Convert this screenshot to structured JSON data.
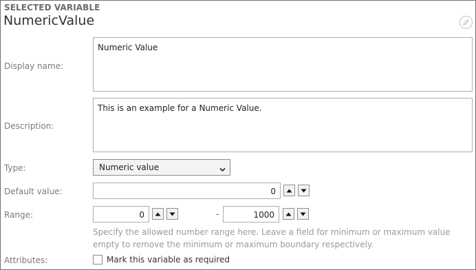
{
  "header": {
    "section_title": "SELECTED VARIABLE",
    "variable_name": "NumericValue",
    "edit_icon": "pencil-circle-icon"
  },
  "fields": {
    "display_name": {
      "label": "Display name:",
      "value": "Numeric Value"
    },
    "description": {
      "label": "Description:",
      "value": "This is an example for a Numeric Value."
    },
    "type": {
      "label": "Type:",
      "selected": "Numeric value"
    },
    "default_value": {
      "label": "Default value:",
      "value": "0"
    },
    "range": {
      "label": "Range:",
      "min": "0",
      "separator": "-",
      "max": "1000",
      "help": "Specify the allowed number range here. Leave a field for minimum or maximum value empty to remove the minimum or maximum boundary respectively."
    },
    "attributes": {
      "label": "Attributes:",
      "required_checkbox_label": "Mark this variable as required",
      "required_checked": false
    }
  },
  "icons": {
    "spin_up": "triangle-up-icon",
    "spin_down": "triangle-down-icon",
    "select_chevron": "chevron-down-icon"
  },
  "colors": {
    "border": "#adadad",
    "label_text": "#7a7a7a",
    "help_text": "#9a9a9a"
  }
}
